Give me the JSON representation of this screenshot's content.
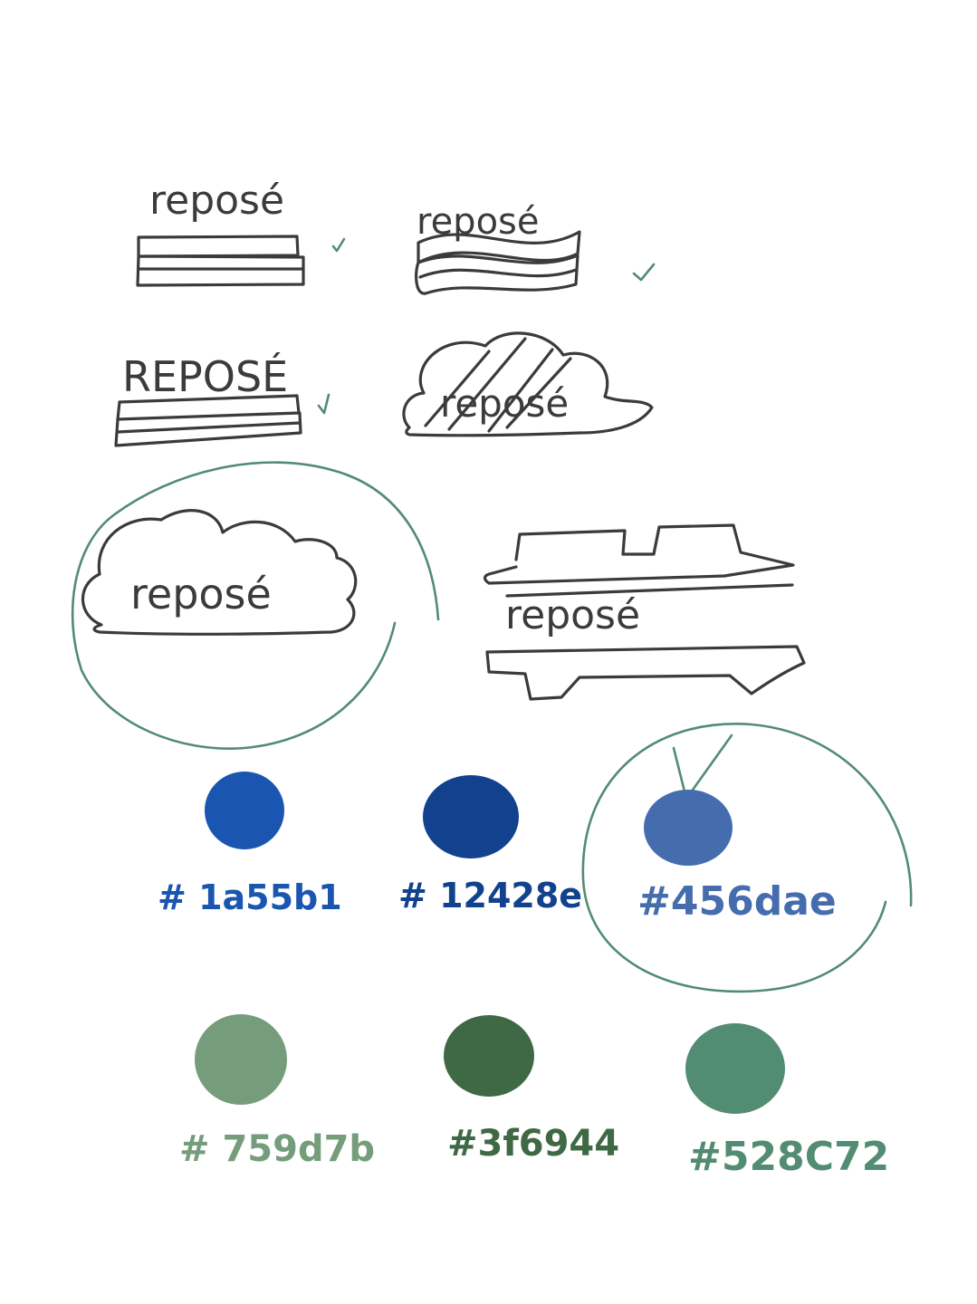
{
  "logos": {
    "stacked_bars": "reposé",
    "wavy_bars": "reposé",
    "caps_bars": "REPOSÉ",
    "hatched_cloud": "reposé",
    "circled_cloud": "reposé",
    "car": "reposé"
  },
  "palette": [
    {
      "hex": "#1a55b1",
      "label": "# 1a55b1"
    },
    {
      "hex": "#12428e",
      "label": "# 12428e"
    },
    {
      "hex": "#456dae",
      "label": "#456dae",
      "selected": true
    },
    {
      "hex": "#759d7b",
      "label": "# 759d7b"
    },
    {
      "hex": "#3f6944",
      "label": "#3f6944"
    },
    {
      "hex": "#528c72",
      "label": "#528C72"
    }
  ],
  "colors": {
    "ink": "#3b3b3b",
    "annotation": "#528c72",
    "background": "#ffffff"
  }
}
